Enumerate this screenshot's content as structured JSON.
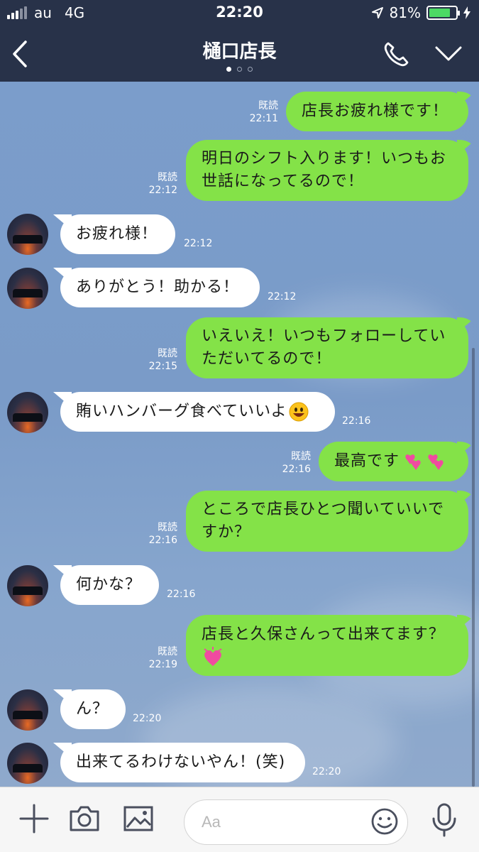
{
  "status_bar": {
    "carrier": "au",
    "network": "4G",
    "time": "22:20",
    "battery": "81%"
  },
  "header": {
    "title": "樋口店長"
  },
  "messages": [
    {
      "side": "out",
      "text": "店長お疲れ様です！",
      "read": "既読",
      "time": "22:11"
    },
    {
      "side": "out",
      "text": "明日のシフト入ります！いつもお世話になってるので！",
      "read": "既読",
      "time": "22:12"
    },
    {
      "side": "in",
      "text": "お疲れ様！",
      "time": "22:12"
    },
    {
      "side": "in",
      "text": "ありがとう！助かる！",
      "time": "22:12"
    },
    {
      "side": "out",
      "text": "いえいえ！いつもフォローしていただいてるので！",
      "read": "既読",
      "time": "22:15"
    },
    {
      "side": "in",
      "text": "賄いハンバーグ食べていいよ",
      "time": "22:16",
      "emoji": "smile"
    },
    {
      "side": "out",
      "text": "最高です",
      "read": "既読",
      "time": "22:16",
      "emoji": "hearts"
    },
    {
      "side": "out",
      "text": "ところで店長ひとつ聞いていいですか？",
      "read": "既読",
      "time": "22:16"
    },
    {
      "side": "in",
      "text": "何かな？",
      "time": "22:16"
    },
    {
      "side": "out",
      "text": "店長と久保さんって出来てます？",
      "read": "既読",
      "time": "22:19",
      "emoji": "heart"
    },
    {
      "side": "in",
      "text": "ん？",
      "time": "22:20"
    },
    {
      "side": "in",
      "text": "出来てるわけないやん！(笑)",
      "time": "22:20"
    }
  ],
  "input": {
    "placeholder": "Aa"
  },
  "icons": [
    "back-icon",
    "phone-icon",
    "chevron-down-icon",
    "plus-icon",
    "camera-icon",
    "image-icon",
    "emoji-icon",
    "microphone-icon"
  ],
  "colors": {
    "header": "#283249",
    "outgoing_bubble": "#84e248",
    "incoming_bubble": "#ffffff",
    "chat_background": "#7b9dcb"
  }
}
